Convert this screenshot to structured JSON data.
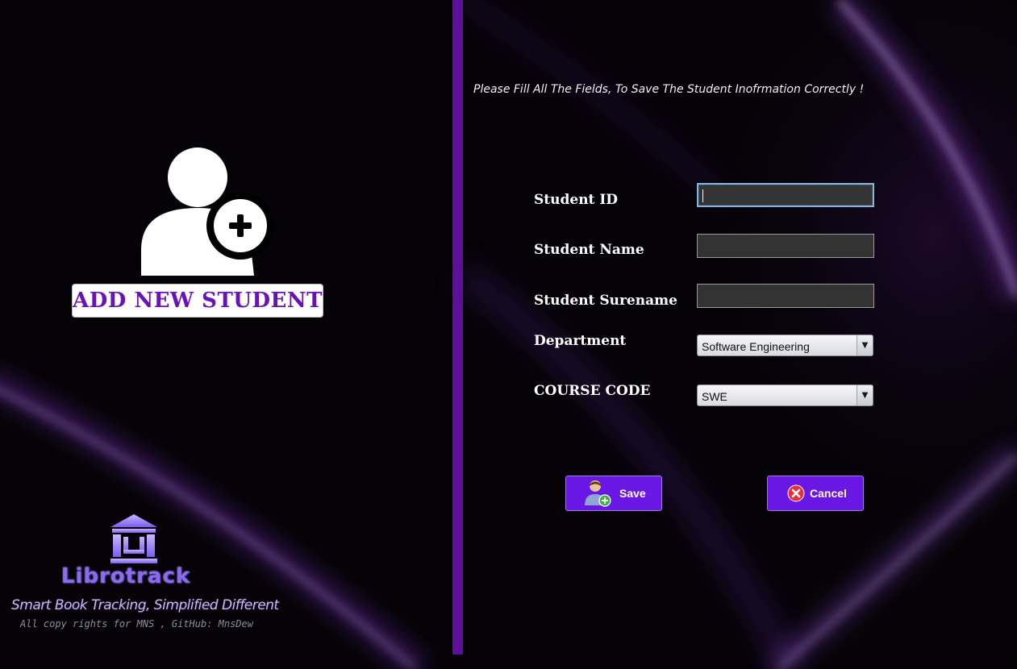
{
  "sidebar": {
    "title": "ADD NEW STUDENT",
    "brand": {
      "name": "Librotrack",
      "tagline": "Smart Book Tracking, Simplified Different",
      "copyright": "All copy rights for MNS , GitHub: MnsDew"
    }
  },
  "form": {
    "instruction": "Please Fill All The Fields, To Save The Student Inofrmation Correctly !",
    "fields": {
      "student_id": {
        "label": "Student ID",
        "value": ""
      },
      "student_name": {
        "label": "Student Name",
        "value": ""
      },
      "student_surname": {
        "label": "Student Surename",
        "value": ""
      },
      "department": {
        "label": "Department",
        "selected": "Software Engineering"
      },
      "course_code": {
        "label": "COURSE CODE",
        "selected": "SWE"
      }
    },
    "buttons": {
      "save": "Save",
      "cancel": "Cancel"
    }
  },
  "icons": {
    "hero": "add-user-icon",
    "logo": "library-icon",
    "save": "add-user-icon",
    "cancel": "cancel-circle-icon"
  },
  "colors": {
    "accent": "#6a17e6",
    "divider": "#5e0f9a",
    "title_text": "#6a12b8",
    "background": "#050307"
  }
}
